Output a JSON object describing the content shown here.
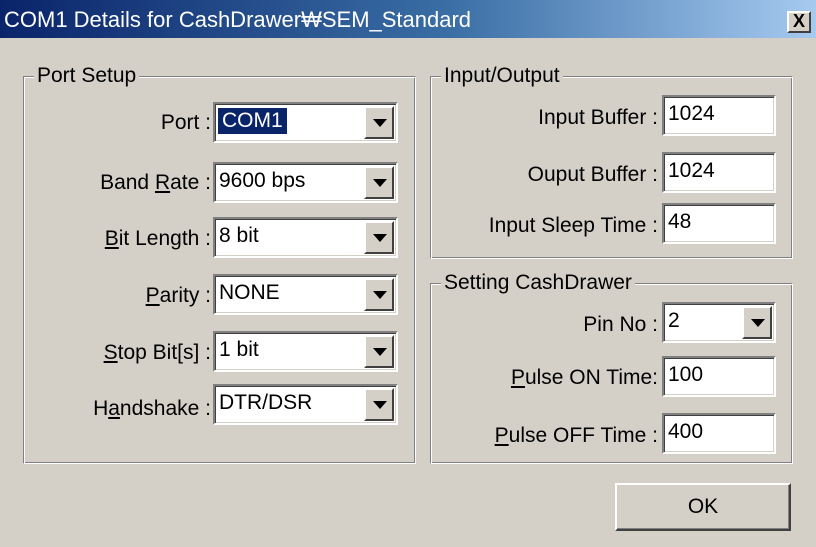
{
  "window": {
    "title": "COM1 Details for CashDrawer₩SEM_Standard",
    "close_glyph": "X"
  },
  "port_setup": {
    "group_label": "Port Setup",
    "fields": [
      {
        "label_pre": "Port :",
        "mnemonic": "",
        "label_post": "",
        "value": "COM1",
        "selected": true
      },
      {
        "label_pre": "Band ",
        "mnemonic": "R",
        "label_post": "ate :",
        "value": "9600 bps"
      },
      {
        "label_pre": "",
        "mnemonic": "B",
        "label_post": "it Length :",
        "value": "8 bit"
      },
      {
        "label_pre": "",
        "mnemonic": "P",
        "label_post": "arity :",
        "value": "NONE"
      },
      {
        "label_pre": "",
        "mnemonic": "S",
        "label_post": "top Bit[s] :",
        "value": "1 bit"
      },
      {
        "label_pre": "H",
        "mnemonic": "a",
        "label_post": "ndshake :",
        "value": "DTR/DSR"
      }
    ]
  },
  "io": {
    "group_label": "Input/Output",
    "input_buffer_label": "Input Buffer :",
    "input_buffer_value": "1024",
    "output_buffer_label": "Ouput Buffer :",
    "output_buffer_value": "1024",
    "sleep_label": "Input Sleep Time :",
    "sleep_value": "48"
  },
  "cashdrawer": {
    "group_label": "Setting CashDrawer",
    "pin_label": "Pin No :",
    "pin_value": "2",
    "pulse_on_mnemonic": "P",
    "pulse_on_rest": "ulse ON Time:",
    "pulse_on_value": "100",
    "pulse_off_mnemonic": "P",
    "pulse_off_rest": "ulse OFF Time :",
    "pulse_off_value": "400"
  },
  "buttons": {
    "ok": "OK"
  },
  "colors": {
    "titlebar": "#0a246a",
    "face": "#d4d0c8",
    "selection": "#0a246a"
  },
  "icons": {
    "dropdown": "chevron-down-icon",
    "close": "close-icon"
  }
}
